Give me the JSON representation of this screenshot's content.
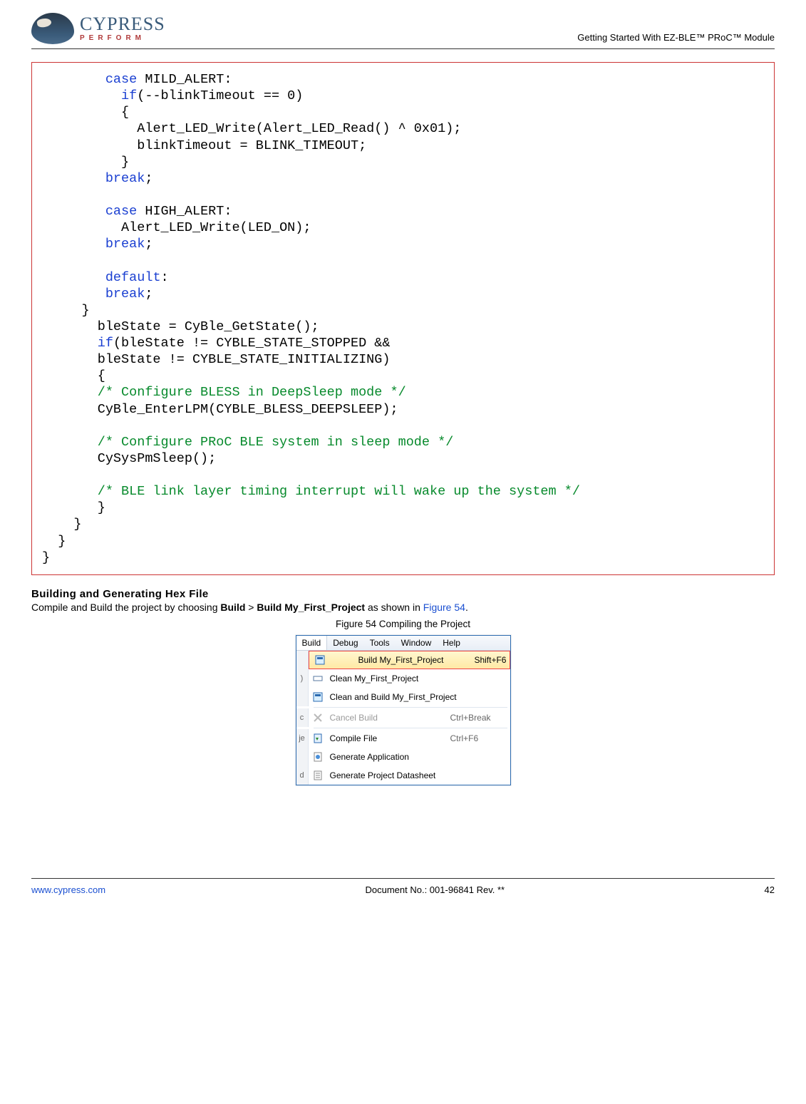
{
  "header": {
    "logo_word": "CYPRESS",
    "logo_tag": "PERFORM",
    "doc_title": "Getting Started With EZ-BLE™ PRoC™ Module"
  },
  "code": {
    "l1_kw": "case",
    "l1_txt": " MILD_ALERT:",
    "l2_kw": "if",
    "l2_txt": "(--blinkTimeout == 0)",
    "l3": "{",
    "l4": "Alert_LED_Write(Alert_LED_Read() ^ 0x01);",
    "l5": "blinkTimeout = BLINK_TIMEOUT;",
    "l6": "}",
    "l7_kw": "break",
    "l7_txt": ";",
    "l9_kw": "case",
    "l9_txt": " HIGH_ALERT:",
    "l10": "Alert_LED_Write(LED_ON);",
    "l11_kw": "break",
    "l11_txt": ";",
    "l13_kw": "default",
    "l13_txt": ":",
    "l14_kw": "break",
    "l14_txt": ";",
    "l15": "}",
    "l16": "bleState = CyBle_GetState();",
    "l17_kw": "if",
    "l17_txt": "(bleState != CYBLE_STATE_STOPPED &&",
    "l18": "bleState != CYBLE_STATE_INITIALIZING)",
    "l19": "{",
    "c20": "/* Configure BLESS in DeepSleep mode */",
    "l21": "CyBle_EnterLPM(CYBLE_BLESS_DEEPSLEEP);",
    "c23": "/* Configure PRoC BLE system in sleep mode */",
    "l24": "CySysPmSleep();",
    "c26": "/* BLE link layer timing interrupt will wake up the system */",
    "l27": "}",
    "l28": "}",
    "l29": "}",
    "l30": "}"
  },
  "section": {
    "heading": "Building and Generating Hex File",
    "sentence_pre": "Compile and Build the project by choosing ",
    "b1": "Build",
    "gt": " > ",
    "b2": "Build My_First_Project",
    "sentence_mid": " as shown in ",
    "figref": "Figure 54",
    "sentence_end": ".",
    "caption": "Figure 54 Compiling the Project"
  },
  "menu": {
    "topbar": [
      "Build",
      "Debug",
      "Tools",
      "Window",
      "Help"
    ],
    "gutter_chars": [
      "",
      ")",
      "",
      "c",
      "je",
      "",
      "d"
    ],
    "items": [
      {
        "icon": "build",
        "label": "Build My_First_Project",
        "underline": "u",
        "shortcut": "Shift+F6",
        "highlight": true
      },
      {
        "icon": "clean",
        "label": "Clean My_First_Project",
        "underline": "l"
      },
      {
        "icon": "build",
        "label": "Clean and Build My_First_Project",
        "underline": "n"
      },
      {
        "icon": "cancel",
        "label": "Cancel Build",
        "shortcut": "Ctrl+Break",
        "disabled": true
      },
      {
        "icon": "compile",
        "label": "Compile File",
        "shortcut": "Ctrl+F6"
      },
      {
        "icon": "generate",
        "label": "Generate Application"
      },
      {
        "icon": "datasheet",
        "label": "Generate Project Datasheet"
      }
    ]
  },
  "footer": {
    "left": "www.cypress.com",
    "center": "Document No.: 001-96841 Rev. **",
    "right": "42"
  }
}
